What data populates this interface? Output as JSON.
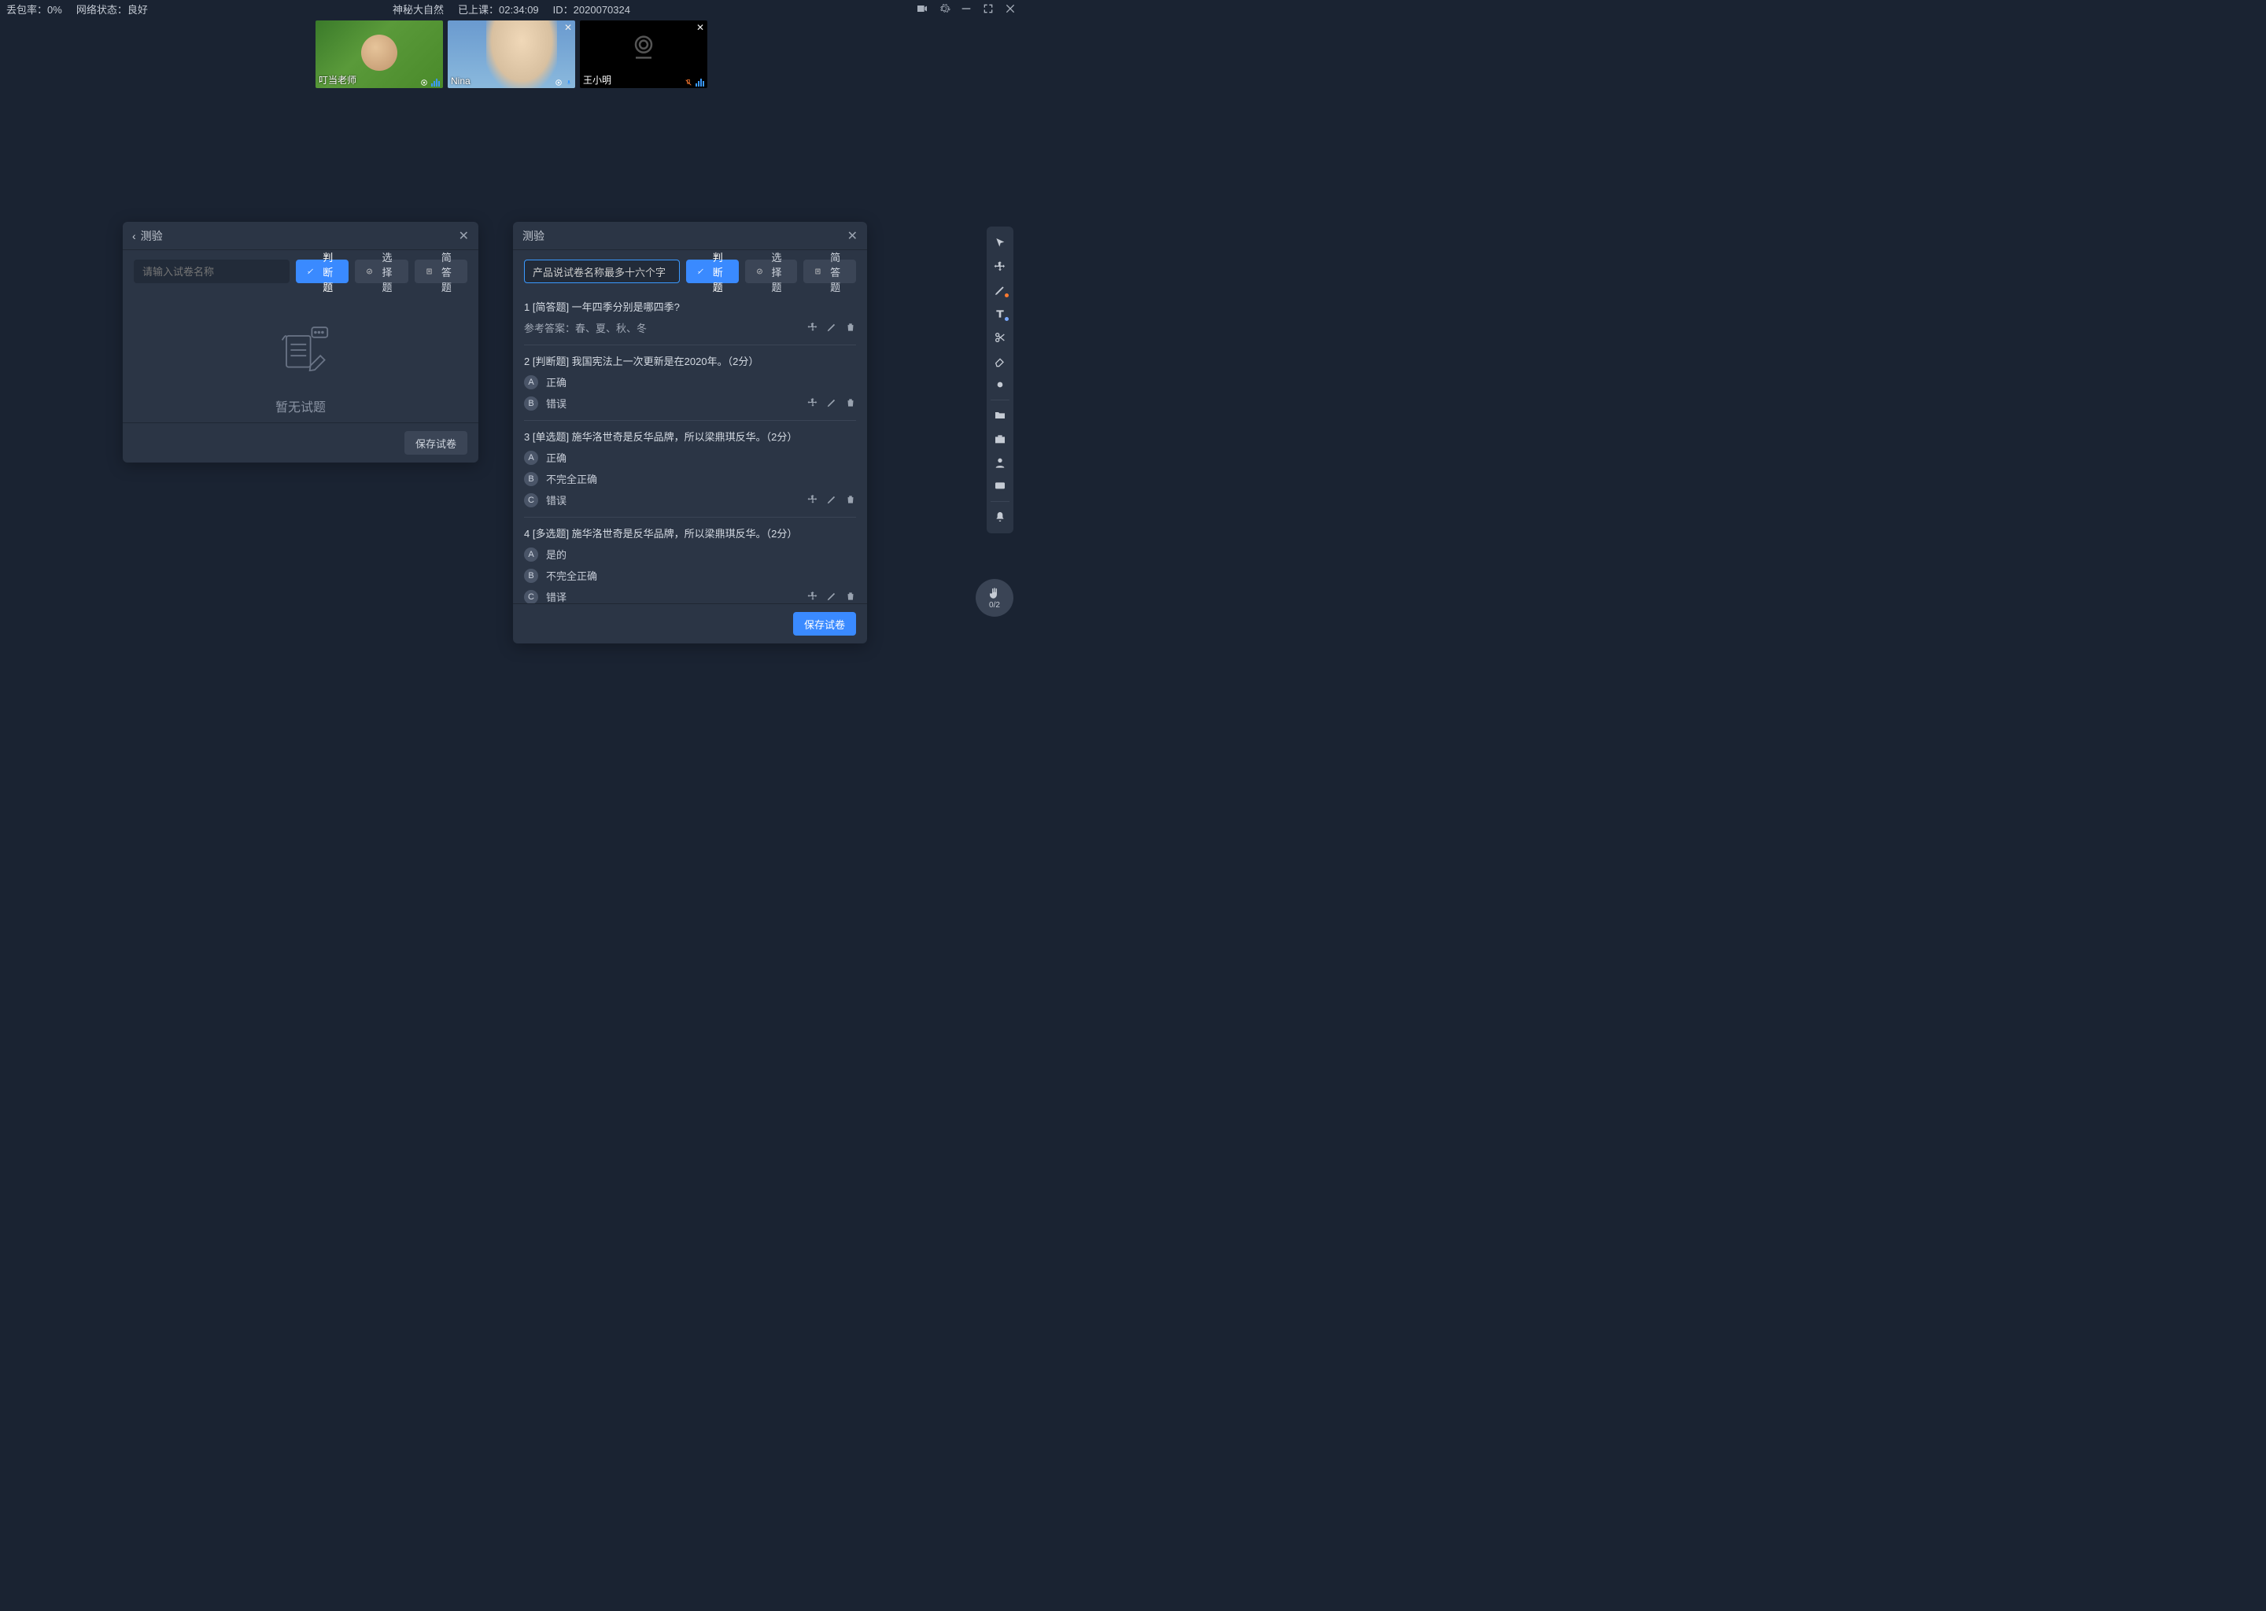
{
  "topbar": {
    "loss_label": "丢包率：",
    "loss_value": "0%",
    "net_label": "网络状态：",
    "net_value": "良好",
    "title": "神秘大自然",
    "elapsed_label": "已上课：",
    "elapsed_value": "02:34:09",
    "id_label": "ID：",
    "id_value": "2020070324"
  },
  "videos": [
    {
      "name": "叮当老师",
      "closable": false,
      "camera_on": true,
      "kind": "teacher"
    },
    {
      "name": "Nina",
      "closable": true,
      "camera_on": true,
      "kind": "nina"
    },
    {
      "name": "王小明",
      "closable": true,
      "camera_on": false,
      "kind": "off"
    }
  ],
  "panel_left": {
    "title": "测验",
    "placeholder": "请输入试卷名称",
    "buttons": {
      "judge": "判断题",
      "choice": "选择题",
      "short": "简答题"
    },
    "empty": "暂无试题",
    "save": "保存试卷"
  },
  "panel_right": {
    "title": "测验",
    "name_value": "产品说试卷名称最多十六个字",
    "buttons": {
      "judge": "判断题",
      "choice": "选择题",
      "short": "简答题"
    },
    "save": "保存试卷",
    "questions": [
      {
        "num": "1",
        "tag": "[简答题]",
        "text": "一年四季分别是哪四季?",
        "answer_label": "参考答案：",
        "answer_text": "春、夏、秋、冬"
      },
      {
        "num": "2",
        "tag": "[判断题]",
        "text": "我国宪法上一次更新是在2020年。",
        "points": "（2分）",
        "options": [
          {
            "letter": "A",
            "text": "正确"
          },
          {
            "letter": "B",
            "text": "错误"
          }
        ]
      },
      {
        "num": "3",
        "tag": "[单选题]",
        "text": "施华洛世奇是反华品牌，所以梁鼎琪反华。",
        "points": "（2分）",
        "options": [
          {
            "letter": "A",
            "text": "正确"
          },
          {
            "letter": "B",
            "text": "不完全正确"
          },
          {
            "letter": "C",
            "text": "错误"
          }
        ]
      },
      {
        "num": "4",
        "tag": "[多选题]",
        "text": "施华洛世奇是反华品牌，所以梁鼎琪反华。",
        "points": "（2分）",
        "options": [
          {
            "letter": "A",
            "text": "是的"
          },
          {
            "letter": "B",
            "text": "不完全正确"
          },
          {
            "letter": "C",
            "text": "错译"
          }
        ]
      }
    ]
  },
  "hand": {
    "count": "0/2"
  }
}
